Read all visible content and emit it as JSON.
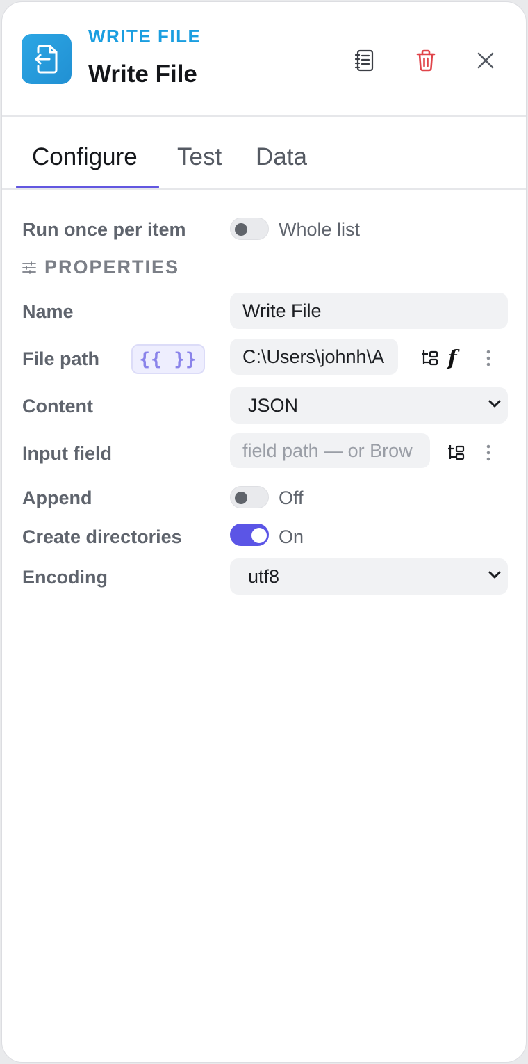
{
  "header": {
    "node_type": "WRITE FILE",
    "node_title": "Write File",
    "icon": "file-export-icon",
    "accent_color": "#1a9ee0",
    "delete_color": "#e0444a"
  },
  "tabs": [
    {
      "label": "Configure",
      "active": true
    },
    {
      "label": "Test",
      "active": false
    },
    {
      "label": "Data",
      "active": false
    }
  ],
  "tab_accent_color": "#6257e0",
  "run_mode": {
    "label": "Run once per item",
    "toggle_text": "Whole list",
    "on": false
  },
  "properties": {
    "section_title": "PROPERTIES",
    "name": {
      "label": "Name",
      "value": "Write File"
    },
    "file_path": {
      "label": "File path",
      "badge": "{{ }}",
      "value": "C:\\Users\\johnh\\A"
    },
    "content": {
      "label": "Content",
      "selected": "JSON"
    },
    "input_field": {
      "label": "Input field",
      "placeholder": "field path — or Brow"
    },
    "append": {
      "label": "Append",
      "toggle_text": "Off",
      "on": false
    },
    "create_directories": {
      "label": "Create directories",
      "toggle_text": "On",
      "on": true
    },
    "encoding": {
      "label": "Encoding",
      "selected": "utf8"
    }
  }
}
